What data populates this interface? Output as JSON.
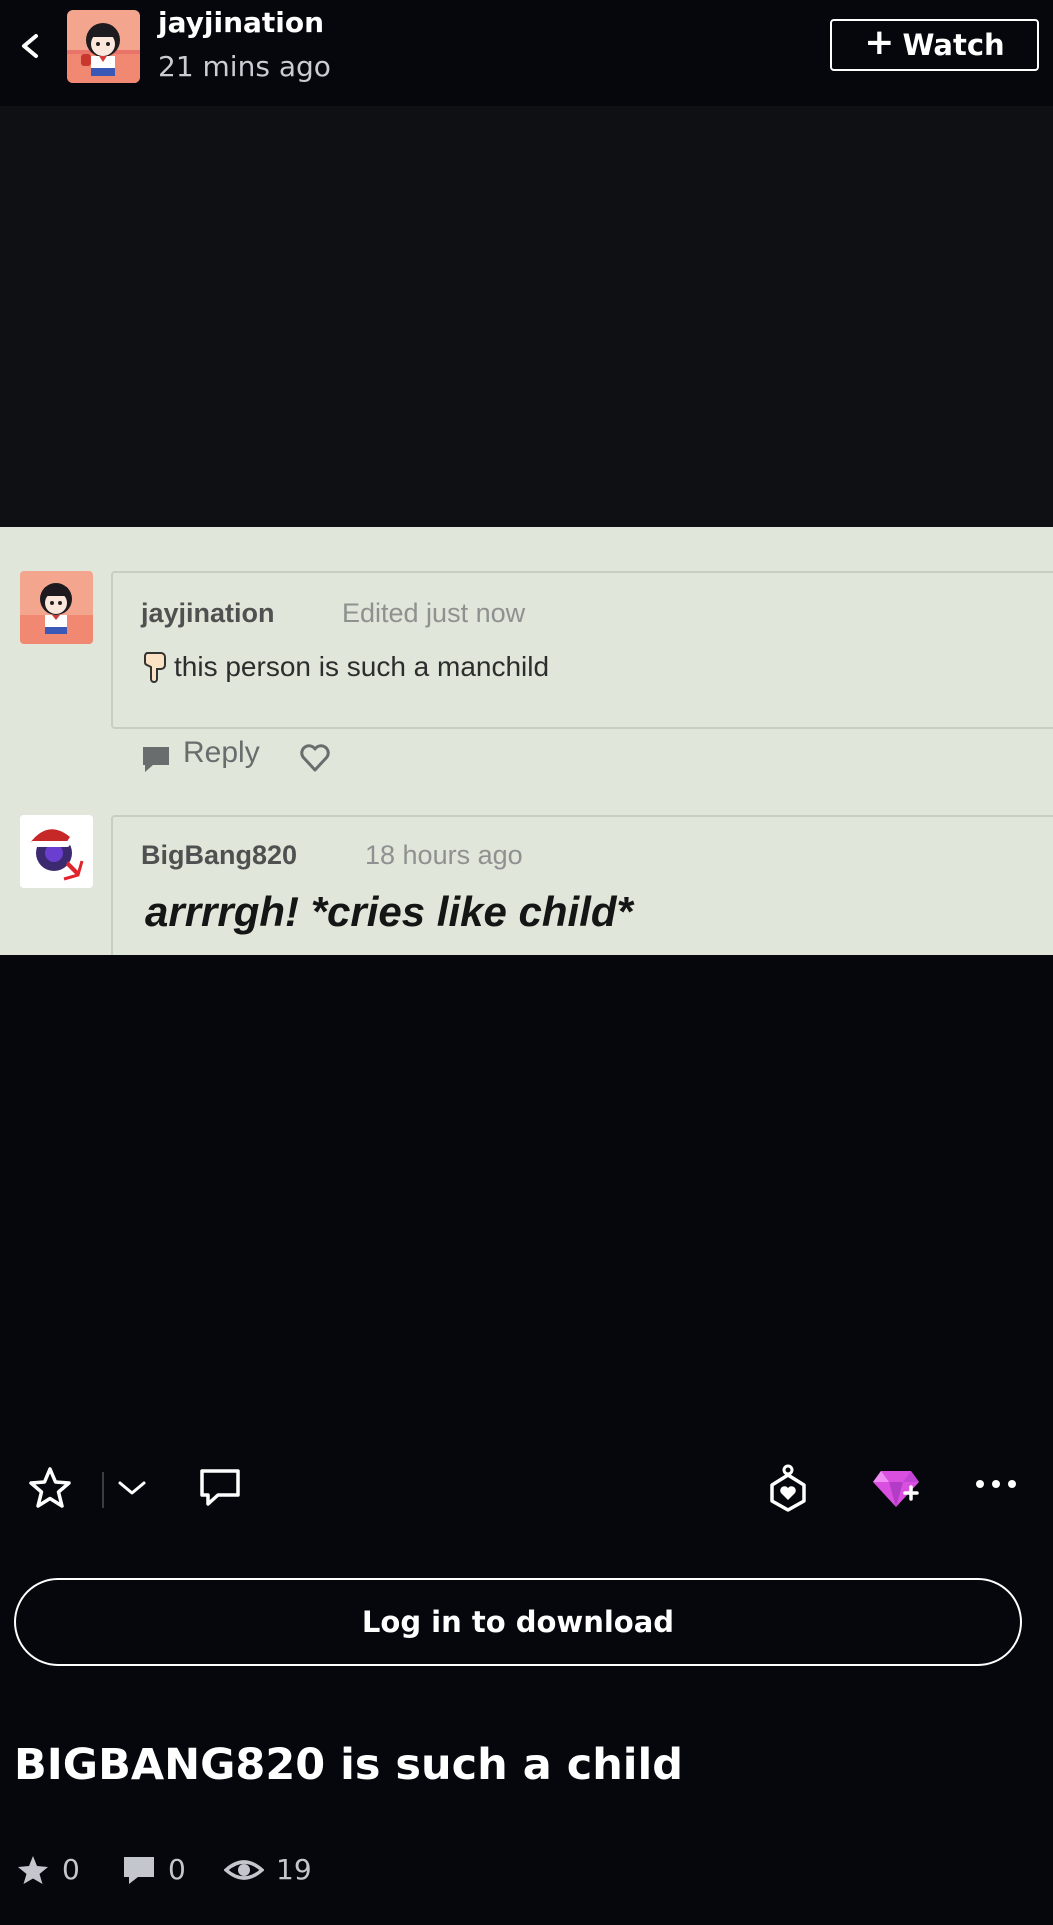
{
  "header": {
    "username": "jayjination",
    "timestamp": "21 mins ago",
    "watch_label": "Watch",
    "back_icon": "chevron-left-icon"
  },
  "screenshot": {
    "comments": [
      {
        "author": "jayjination",
        "meta": "Edited just now",
        "text": "this person is such a manchild",
        "reply_label": "Reply"
      },
      {
        "author": "BigBang820",
        "meta": "18 hours ago",
        "text": "arrrrgh! *cries like child*"
      }
    ]
  },
  "actions": {
    "icons": [
      "star-icon",
      "chevron-down-icon",
      "comment-icon",
      "badge-icon",
      "gem-icon",
      "more-icon"
    ],
    "gem_color": "#e05cf0"
  },
  "download": {
    "label": "Log in to download"
  },
  "post": {
    "title": "BIGBANG820 is such a child",
    "stats": {
      "favorites": "0",
      "comments": "0",
      "views": "19"
    }
  }
}
